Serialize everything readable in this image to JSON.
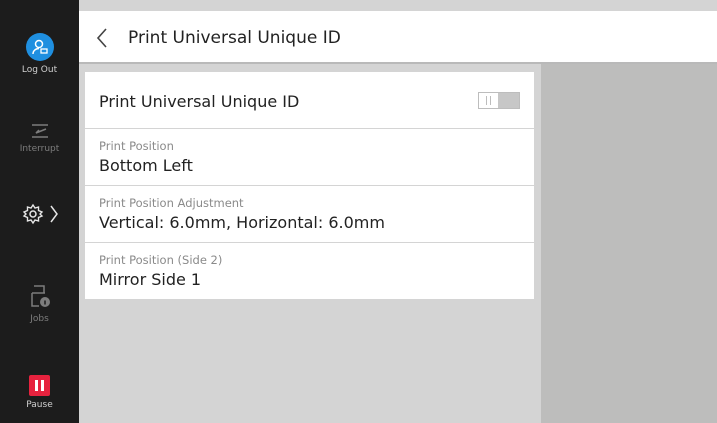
{
  "sidebar": {
    "logout_label": "Log Out",
    "interrupt_label": "Interrupt",
    "jobs_label": "Jobs",
    "pause_label": "Pause"
  },
  "header": {
    "title": "Print Universal Unique ID"
  },
  "settings": [
    {
      "label": "Print Universal Unique ID",
      "toggle_on": false
    },
    {
      "label": "Print Position",
      "value": "Bottom Left"
    },
    {
      "label": "Print Position Adjustment",
      "value": "Vertical: 6.0mm, Horizontal: 6.0mm"
    },
    {
      "label": "Print Position (Side 2)",
      "value": "Mirror Side 1"
    }
  ],
  "colors": {
    "accent_blue": "#1f8fe0",
    "pause_red": "#e6223e",
    "sidebar_bg": "#1c1c1c"
  }
}
